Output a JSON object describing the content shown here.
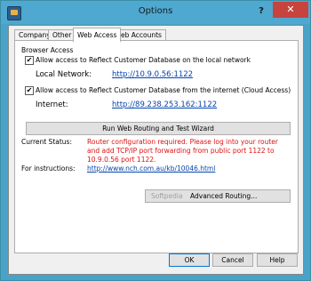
{
  "window": {
    "title": "Options",
    "help_glyph": "?",
    "close_glyph": "✕"
  },
  "tabs": [
    {
      "label": "Company",
      "active": false
    },
    {
      "label": "Other",
      "active": false
    },
    {
      "label": "Web Access",
      "active": true
    },
    {
      "label": "Web Accounts",
      "active": false
    }
  ],
  "browser_access": {
    "group_label": "Browser Access",
    "local_checkbox": {
      "label": "Allow access to Reflect Customer Database on the local network",
      "checked": true,
      "mark": "✔"
    },
    "local_network_label": "Local Network:",
    "local_network_url": "http://10.9.0.56:1122",
    "internet_checkbox": {
      "label": "Allow access to Reflect Customer Database from the internet (Cloud Access)",
      "checked": true,
      "mark": "✔"
    },
    "internet_label": "Internet:",
    "internet_url": "http://89.238.253.162:1122",
    "wizard_button": "Run Web Routing and Test Wizard"
  },
  "status": {
    "label": "Current Status:",
    "text": "Router configuration required. Please log into your router and add TCP/IP port forwarding from public port 1122 to 10.9.0.56 port 1122.",
    "color": "#e01010"
  },
  "instructions": {
    "label": "For instructions:",
    "url": "http://www.nch.com.au/kb/10046.html"
  },
  "advanced_button": {
    "faded_text": "Softpedia",
    "label": "Advanced Routing..."
  },
  "footer": {
    "ok": "OK",
    "cancel": "Cancel",
    "help": "Help"
  }
}
